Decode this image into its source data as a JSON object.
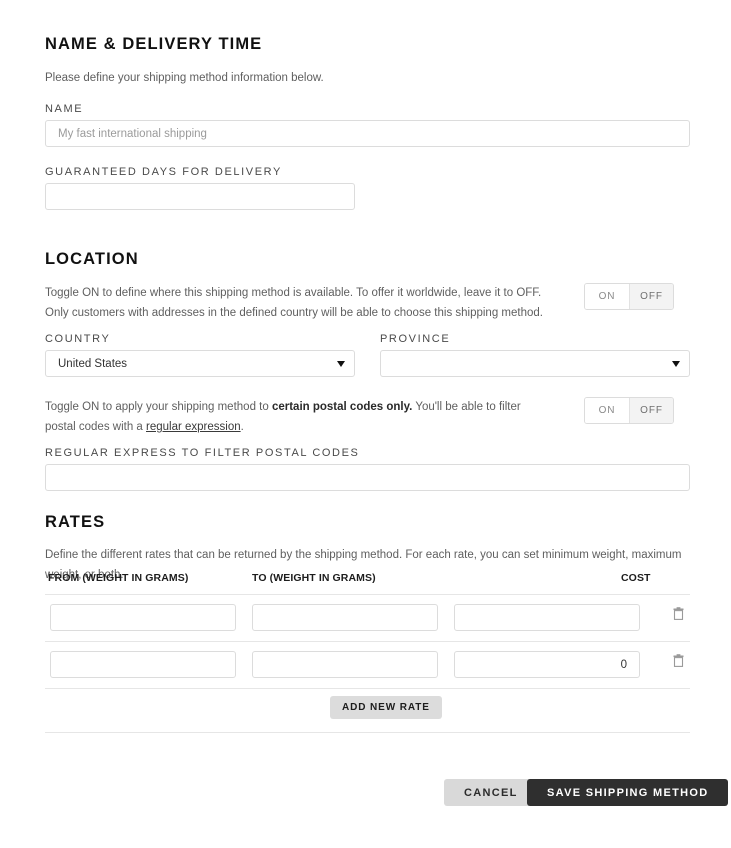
{
  "sections": {
    "name_delivery": {
      "title": "NAME & DELIVERY TIME",
      "description": "Please define your shipping method information below.",
      "name_label": "NAME",
      "name_placeholder": "My fast international shipping",
      "name_value": "",
      "days_label": "GUARANTEED DAYS FOR DELIVERY",
      "days_value": "",
      "days_placeholder": ""
    },
    "location": {
      "title": "LOCATION",
      "description_line1": "Toggle ON to define where this shipping method is available. To offer it worldwide, leave it to OFF. Only customers with",
      "description_line2": "addresses in the defined country will be able to choose this shipping method.",
      "toggle_on": "ON",
      "toggle_off": "OFF",
      "toggle_state": "OFF",
      "country_label": "COUNTRY",
      "country_value": "United States",
      "province_label": "PROVINCE",
      "province_value": "",
      "postal_desc_part1": "Toggle ON to apply your shipping method to ",
      "postal_desc_bold": "certain postal codes only.",
      "postal_desc_part2": " You'll be able to filter postal codes with a",
      "postal_link": "regular expression",
      "postal_desc_end": ".",
      "postal_toggle_on": "ON",
      "postal_toggle_off": "OFF",
      "postal_toggle_state": "OFF",
      "regex_label": "REGULAR EXPRESS TO FILTER POSTAL CODES",
      "regex_value": "",
      "regex_placeholder": ""
    },
    "rates": {
      "title": "RATES",
      "description": "Define the different rates that can be returned by the shipping method. For each rate, you can set minimum weight, maximum weight, or both.",
      "columns": [
        "FROM (WEIGHT IN GRAMS)",
        "TO (WEIGHT IN GRAMS)",
        "COST"
      ],
      "rows": [
        {
          "from": "",
          "to": "",
          "cost": "",
          "delete_icon": "trash-icon"
        },
        {
          "from": "",
          "to": "",
          "cost": "0",
          "delete_icon": "trash-icon"
        }
      ],
      "add_button": "ADD NEW RATE"
    }
  },
  "footer": {
    "cancel_label": "CANCEL",
    "save_label": "SAVE SHIPPING METHOD"
  },
  "colors": {
    "accent_dark": "#2f2f2f",
    "border": "#dcdcdc",
    "muted_text": "#5f5f5f",
    "toggle_off_bg": "#f3f3f3"
  }
}
